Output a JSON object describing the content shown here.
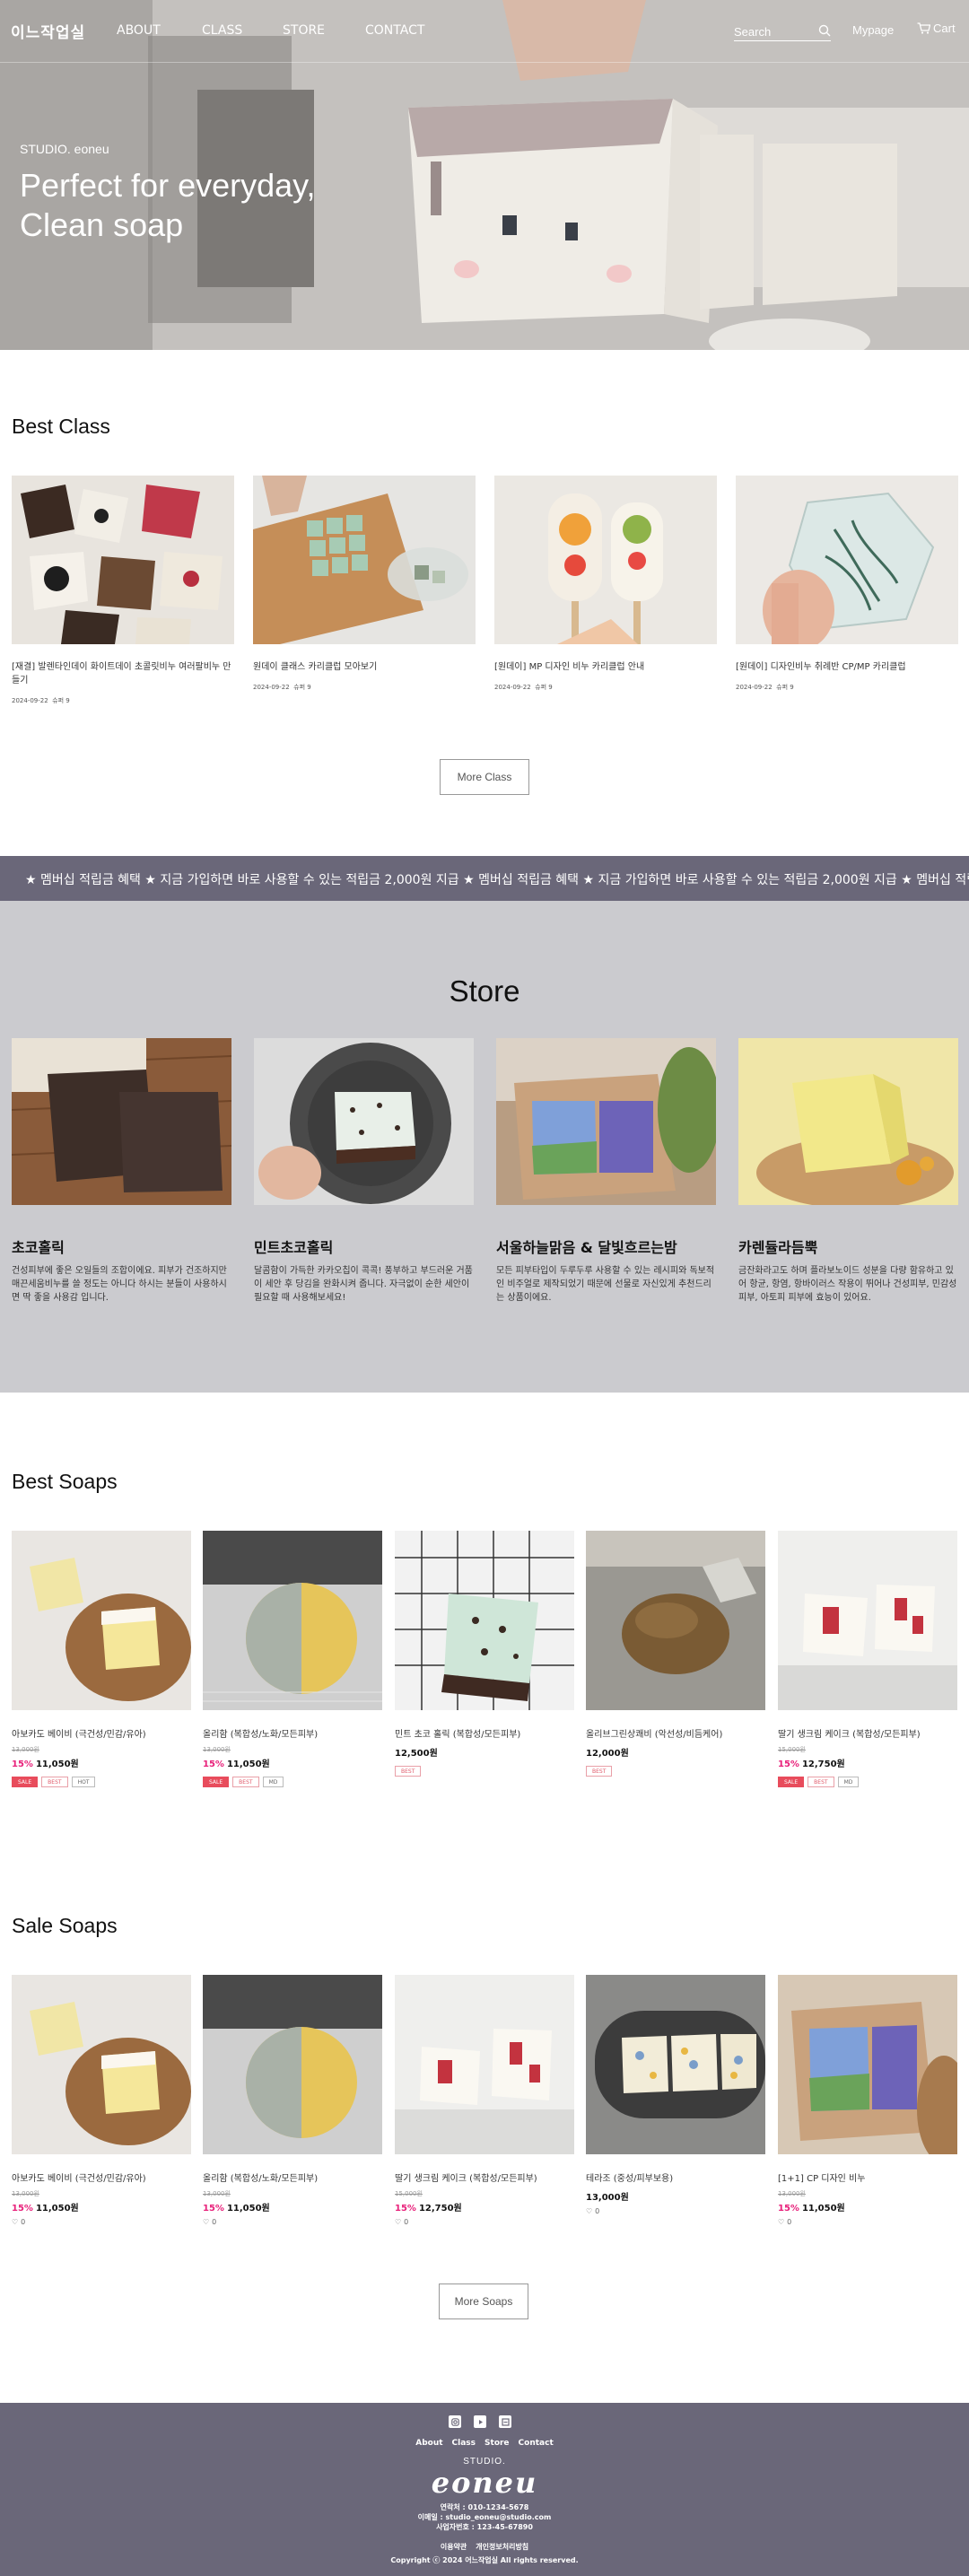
{
  "header": {
    "logo": "이느작업실",
    "nav": [
      "ABOUT",
      "CLASS",
      "STORE",
      "CONTACT"
    ],
    "search_placeholder": "Search",
    "mypage": "Mypage",
    "cart": "Cart"
  },
  "hero": {
    "kicker": "STUDIO. eoneu",
    "title_line1": "Perfect for everyday,",
    "title_line2": "Clean soap"
  },
  "best_class": {
    "title": "Best Class",
    "items": [
      {
        "title": "[재결] 발렌타인데이 화이트데이 초콜릿비누 여러팔비누 만들기",
        "date": "2024-09-22",
        "rating": "슈퍼 9"
      },
      {
        "title": "원데이 클래스 카리클럽 모아보기",
        "date": "2024-09-22",
        "rating": "슈퍼 9"
      },
      {
        "title": "[원데이] MP 디자인 비누 카리클럽 안내",
        "date": "2024-09-22",
        "rating": "슈퍼 9"
      },
      {
        "title": "[원데이] 디자인비누 취례반 CP/MP 카리클럽",
        "date": "2024-09-22",
        "rating": "슈퍼 9"
      }
    ],
    "more": "More Class"
  },
  "marquee": "★ 멤버십 적립금 혜택 ★ 지금 가입하면 바로 사용할 수 있는 적립금 2,000원 지급 ★ 멤버십 적립금 혜택 ★ 지금 가입하면 바로 사용할 수 있는 적립금 2,000원 지급 ★ 멤버십 적립금 혜택 ★ 지금 가입",
  "store": {
    "title": "Store",
    "items": [
      {
        "name": "초코홀릭",
        "desc": "건성피부에 좋은 오일들의 조합이에요. 피부가 건조하지만 매끈세움비누를 쓸 정도는 아니다 하시는 분들이 사용하시면 딱 좋을 사용감 입니다."
      },
      {
        "name": "민트초코홀릭",
        "desc": "달콤함이 가득한 카카오칩이 콕콕! 풍부하고 부드러운 거품이 세안 후 당김을 완화시켜 줍니다. 자극없이 순한 세안이 필요할 때 사용해보세요!"
      },
      {
        "name": "서울하늘맑음 & 달빛흐르는밤",
        "desc": "모든 피부타입이 두루두루 사용할 수 있는 레시피와 독보적인 비주얼로 제작되었기 때문에 선물로 자신있게 추천드리는 상품이에요."
      },
      {
        "name": "카렌듈라듬뿍",
        "desc": "금잔화라고도 하며 플라보노이드 성분을 다량 함유하고 있어 항균, 항염, 항바이러스 작용이 뛰어나 건성피부, 민감성 피부, 아토피 피부에 효능이 있어요."
      }
    ]
  },
  "best_soaps": {
    "title": "Best Soaps",
    "items": [
      {
        "name": "아보카도 베이비 (극건성/민감/유아)",
        "orig": "13,000원",
        "pct": "15%",
        "price": "11,050원",
        "badges": [
          "SALE",
          "BEST",
          "HOT"
        ]
      },
      {
        "name": "올리함 (복합성/노화/모든피부)",
        "orig": "13,000원",
        "pct": "15%",
        "price": "11,050원",
        "badges": [
          "SALE",
          "BEST",
          "MD"
        ]
      },
      {
        "name": "민트 초코 홀릭 (복합성/모든피부)",
        "orig": "",
        "pct": "",
        "price": "12,500원",
        "badges": [
          "BEST"
        ]
      },
      {
        "name": "올리브그린상쾌비 (악선성/비듬케어)",
        "orig": "",
        "pct": "",
        "price": "12,000원",
        "badges": [
          "BEST"
        ]
      },
      {
        "name": "딸기 생크림 케이크 (복합성/모든피부)",
        "orig": "15,000원",
        "pct": "15%",
        "price": "12,750원",
        "badges": [
          "SALE",
          "BEST",
          "MD"
        ]
      }
    ]
  },
  "sale_soaps": {
    "title": "Sale Soaps",
    "items": [
      {
        "name": "아보카도 베이비 (극건성/민감/유아)",
        "orig": "13,000원",
        "pct": "15%",
        "price": "11,050원",
        "likes": "0"
      },
      {
        "name": "올리함 (복합성/노화/모든피부)",
        "orig": "13,000원",
        "pct": "15%",
        "price": "11,050원",
        "likes": "0"
      },
      {
        "name": "딸기 생크림 케이크 (복합성/모든피부)",
        "orig": "15,000원",
        "pct": "15%",
        "price": "12,750원",
        "likes": "0"
      },
      {
        "name": "테라조 (중성/피부보용)",
        "orig": "",
        "pct": "",
        "price": "13,000원",
        "likes": "0"
      },
      {
        "name": "[1+1] CP 디자인 비누",
        "orig": "13,000원",
        "pct": "15%",
        "price": "11,050원",
        "likes": "0"
      }
    ],
    "more": "More Soaps"
  },
  "footer": {
    "links": [
      "About",
      "Class",
      "Store",
      "Contact"
    ],
    "studio": "STUDIO.",
    "brand": "eoneu",
    "phone": "연락처 : 010-1234-5678",
    "email": "이메일 : studio_eoneu@studio.com",
    "bizno": "사업자번호 : 123-45-67890",
    "terms": "이용약관",
    "privacy": "개인정보처리방침",
    "copyright": "Copyright ⓒ 2024 어느작업실 All rights reserved."
  },
  "colors": {
    "accent_band": "#6a6779",
    "store_bg": "#cbcbcf",
    "discount": "#e8207a",
    "sale_badge": "#e84c5c"
  }
}
